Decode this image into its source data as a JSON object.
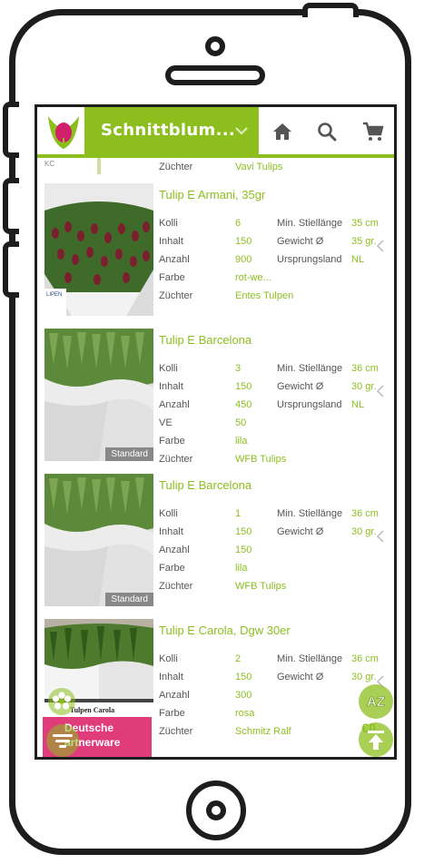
{
  "app": {
    "title": "Schnittblum...",
    "accent_color": "#8cbf1e",
    "pink_color": "#e03b7b"
  },
  "header_icons": [
    "home-icon",
    "search-icon",
    "cart-icon"
  ],
  "partial_top": {
    "code": "KC",
    "label": "Züchter",
    "value": "Vavi Tulips"
  },
  "items": [
    {
      "title": "Tulip E Armani, 35gr",
      "thumb_caption": "LIPEN",
      "rows": [
        {
          "l1": "Kolli",
          "v1": "6",
          "l2": "Min. Stiellänge",
          "v2": "35 cm"
        },
        {
          "l1": "Inhalt",
          "v1": "150",
          "l2": "Gewicht Ø",
          "v2": "35 gr."
        },
        {
          "l1": "Anzahl",
          "v1": "900",
          "l2": "Ursprungsland",
          "v2": "NL"
        },
        {
          "l1": "Farbe",
          "v1": "rot-we...",
          "l2": "",
          "v2": ""
        },
        {
          "l1": "Züchter",
          "v1": "Entes Tulpen",
          "l2": "",
          "v2": ""
        }
      ]
    },
    {
      "title": "Tulip E Barcelona",
      "badge": "Standard",
      "rows": [
        {
          "l1": "Kolli",
          "v1": "3",
          "l2": "Min. Stiellänge",
          "v2": "36 cm"
        },
        {
          "l1": "Inhalt",
          "v1": "150",
          "l2": "Gewicht Ø",
          "v2": "30 gr."
        },
        {
          "l1": "Anzahl",
          "v1": "450",
          "l2": "Ursprungsland",
          "v2": "NL"
        },
        {
          "l1": "VE",
          "v1": "50",
          "l2": "",
          "v2": ""
        },
        {
          "l1": "Farbe",
          "v1": "lila",
          "l2": "",
          "v2": ""
        },
        {
          "l1": "Züchter",
          "v1": "WFB Tulips",
          "l2": "",
          "v2": ""
        }
      ]
    },
    {
      "title": "Tulip E Barcelona",
      "badge": "Standard",
      "rows": [
        {
          "l1": "Kolli",
          "v1": "1",
          "l2": "Min. Stiellänge",
          "v2": "36 cm"
        },
        {
          "l1": "Inhalt",
          "v1": "150",
          "l2": "Gewicht Ø",
          "v2": "30 gr."
        },
        {
          "l1": "Anzahl",
          "v1": "150",
          "l2": "",
          "v2": ""
        },
        {
          "l1": "Farbe",
          "v1": "lila",
          "l2": "",
          "v2": ""
        },
        {
          "l1": "Züchter",
          "v1": "WFB Tulips",
          "l2": "",
          "v2": ""
        }
      ]
    },
    {
      "title": "Tulip E Carola, Dgw 30er",
      "thumb_caption": "Tulpen Carola",
      "rows": [
        {
          "l1": "Kolli",
          "v1": "2",
          "l2": "Min. Stiellänge",
          "v2": "36 cm"
        },
        {
          "l1": "Inhalt",
          "v1": "150",
          "l2": "Gewicht Ø",
          "v2": "30 gr."
        },
        {
          "l1": "Anzahl",
          "v1": "300",
          "l2": "",
          "v2": ""
        },
        {
          "l1": "Farbe",
          "v1": "rosa",
          "l2": "",
          "v2": ""
        },
        {
          "l1": "Züchter",
          "v1": "Schmitz Ralf",
          "l2": "",
          "v2": ""
        }
      ],
      "price_partial": "€0"
    }
  ],
  "banner": {
    "line1": "Deutsche",
    "line2": "artnerware"
  },
  "floating": {
    "sort_label": "AZ",
    "icons": [
      "flower-icon",
      "filter-icon",
      "sort-az-icon",
      "scroll-top-icon"
    ]
  }
}
